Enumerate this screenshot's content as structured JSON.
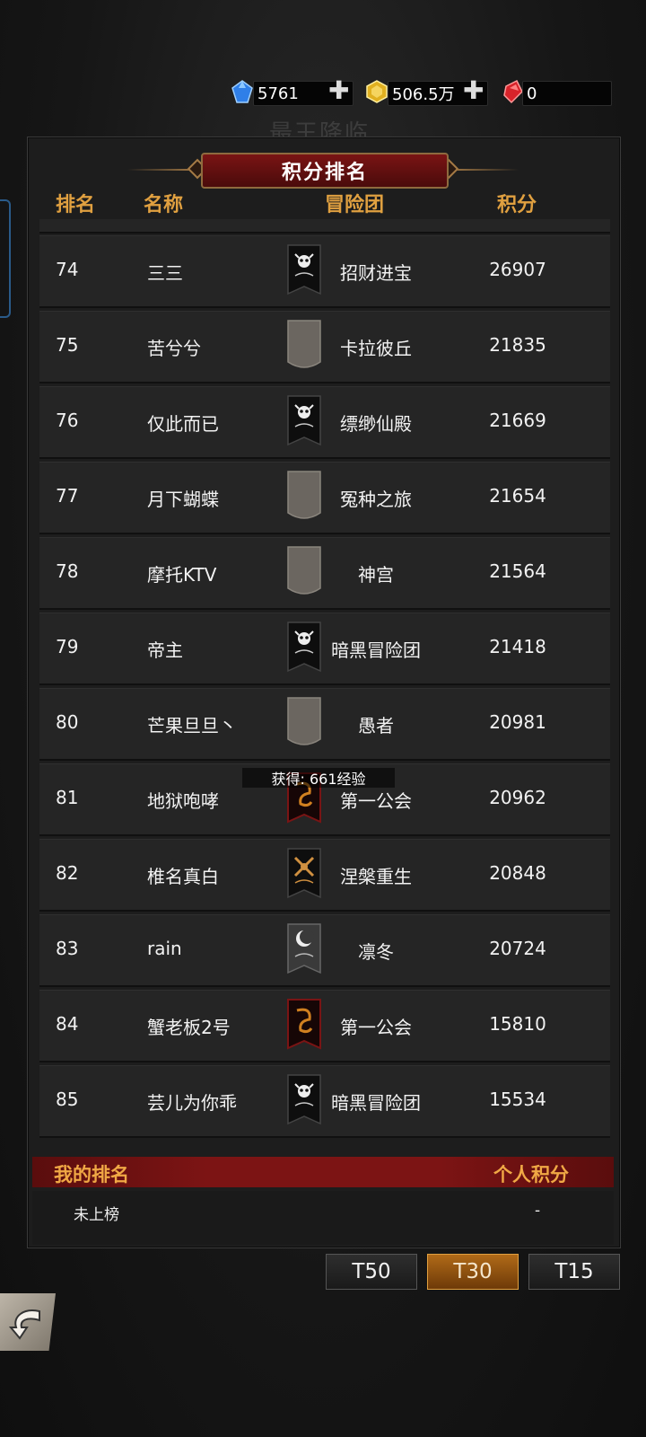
{
  "currency": {
    "diamonds": "5761",
    "gold": "506.5万",
    "rubies": "0",
    "icons": [
      "blue-gem-icon",
      "gold-coin-icon",
      "red-gem-icon",
      "plus-icon"
    ]
  },
  "background_text": "最王降临",
  "panel": {
    "title": "积分排名",
    "columns": {
      "rank": "排名",
      "name": "名称",
      "team": "冒险团",
      "score": "积分"
    }
  },
  "rows": [
    {
      "rank": "74",
      "name": "三三",
      "team": "招财进宝",
      "score": "26907",
      "emblem": "skull-banner-icon"
    },
    {
      "rank": "75",
      "name": "苦兮兮",
      "team": "卡拉彼丘",
      "score": "21835",
      "emblem": "blank-banner-icon"
    },
    {
      "rank": "76",
      "name": "仅此而已",
      "team": "缥缈仙殿",
      "score": "21669",
      "emblem": "skull-banner-icon"
    },
    {
      "rank": "77",
      "name": "月下蝴蝶",
      "team": "冤种之旅",
      "score": "21654",
      "emblem": "blank-banner-icon"
    },
    {
      "rank": "78",
      "name": "摩托KTV",
      "team": "神宫",
      "score": "21564",
      "emblem": "blank-banner-icon"
    },
    {
      "rank": "79",
      "name": "帝主",
      "team": "暗黑冒险团",
      "score": "21418",
      "emblem": "skull-banner-icon"
    },
    {
      "rank": "80",
      "name": "芒果旦旦丶",
      "team": "愚者",
      "score": "20981",
      "emblem": "blank-banner-icon"
    },
    {
      "rank": "81",
      "name": "地狱咆哮",
      "team": "第一公会",
      "score": "20962",
      "emblem": "dragon-banner-icon"
    },
    {
      "rank": "82",
      "name": "椎名真白",
      "team": "涅槃重生",
      "score": "20848",
      "emblem": "axe-banner-icon"
    },
    {
      "rank": "83",
      "name": "rain",
      "team": "凛冬",
      "score": "20724",
      "emblem": "moon-banner-icon"
    },
    {
      "rank": "84",
      "name": "蟹老板2号",
      "team": "第一公会",
      "score": "15810",
      "emblem": "dragon-banner-icon"
    },
    {
      "rank": "85",
      "name": "芸儿为你乖",
      "team": "暗黑冒险团",
      "score": "15534",
      "emblem": "skull-banner-icon"
    }
  ],
  "toast": "获得: 661经验",
  "my_rank": {
    "label": "我的排名",
    "score_label": "个人积分",
    "rank_value": "未上榜",
    "score_value": "-"
  },
  "tiers": [
    {
      "label": "T50",
      "active": false
    },
    {
      "label": "T30",
      "active": true
    },
    {
      "label": "T15",
      "active": false
    }
  ],
  "colors": {
    "accent_gold": "#e0a040",
    "banner_red": "#7a1414",
    "active_tier": "#b06a18"
  }
}
